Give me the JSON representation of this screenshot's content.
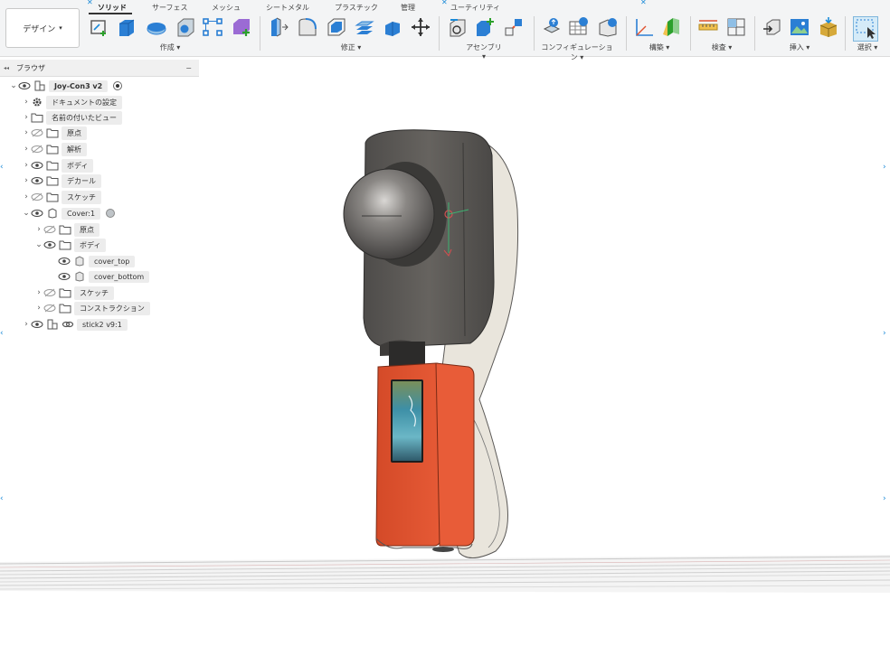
{
  "workspace": {
    "label": "デザイン",
    "caret": "▾"
  },
  "tabs": [
    {
      "label": "ソリッド",
      "active": true
    },
    {
      "label": "サーフェス"
    },
    {
      "label": "メッシュ"
    },
    {
      "label": "シートメタル"
    },
    {
      "label": "プラスチック"
    },
    {
      "label": "管理"
    },
    {
      "label": "ユーティリティ"
    }
  ],
  "groups": [
    {
      "label": "作成 ▾"
    },
    {
      "label": "修正 ▾"
    },
    {
      "label": "アセンブリ ▾"
    },
    {
      "label": "コンフィギュレーション ▾"
    },
    {
      "label": "構築 ▾"
    },
    {
      "label": "検査 ▾"
    },
    {
      "label": "挿入 ▾"
    },
    {
      "label": "選択 ▾"
    }
  ],
  "browser": {
    "title": "ブラウザ",
    "collapse": "◂◂",
    "minimize": "−",
    "items": [
      {
        "label": "Joy-Con3 v2"
      },
      {
        "label": "ドキュメントの設定"
      },
      {
        "label": "名前の付いたビュー"
      },
      {
        "label": "原点"
      },
      {
        "label": "解析"
      },
      {
        "label": "ボディ"
      },
      {
        "label": "デカール"
      },
      {
        "label": "スケッチ"
      },
      {
        "label": "Cover:1"
      },
      {
        "label": "原点"
      },
      {
        "label": "ボディ"
      },
      {
        "label": "cover_top"
      },
      {
        "label": "cover_bottom"
      },
      {
        "label": "スケッチ"
      },
      {
        "label": "コンストラクション"
      },
      {
        "label": "stick2 v9:1"
      }
    ]
  },
  "colors": {
    "accent": "#1a8ad8",
    "cover_orange": "#e0532f",
    "body_dark": "#5a5856",
    "body_light": "#ece8e0"
  }
}
